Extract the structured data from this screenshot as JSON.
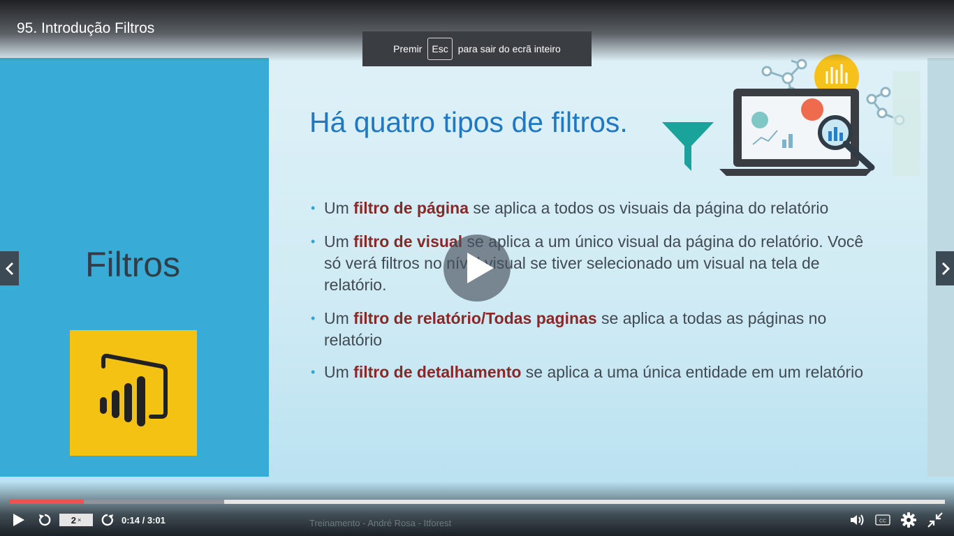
{
  "player": {
    "video_title": "95. Introdução Filtros",
    "fullscreen_notice": {
      "prefix": "Premir",
      "key": "Esc",
      "suffix": "para sair do ecrã inteiro"
    },
    "current_time": "0:14",
    "duration": "3:01",
    "time_display": "0:14 / 3:01",
    "playback_rate": "2",
    "playback_rate_suffix": "×",
    "progress_played_fraction": 0.08,
    "progress_buffered_fraction": 0.23,
    "icons": {
      "play": "play-icon",
      "rewind": "rewind-5s-icon",
      "forward": "forward-5s-icon",
      "volume": "volume-icon",
      "captions": "captions-icon",
      "settings": "gear-icon",
      "exit_fullscreen": "exit-fullscreen-icon",
      "prev": "chevron-left-icon",
      "next": "chevron-right-icon"
    },
    "colors": {
      "progress_played": "#ec5252",
      "progress_buffer": "#8f959b"
    }
  },
  "slide": {
    "left_title": "Filtros",
    "title": "Há quatro tipos de filtros.",
    "bullets": [
      {
        "pre": "Um ",
        "bold": "filtro de página",
        "post": " se aplica a todos os visuais da página do relatório"
      },
      {
        "pre": "Um ",
        "bold": "filtro de visual",
        "post": " se aplica a um único visual da página do relatório. Você só verá filtros no nível visual se tiver selecionado um visual na tela de relatório."
      },
      {
        "pre": "Um ",
        "bold": "filtro de relatório/Todas paginas",
        "post": " se aplica a todas as páginas no relatório"
      },
      {
        "pre": "Um ",
        "bold": "filtro de detalhamento",
        "post": " se aplica a uma única entidade em um relatório"
      }
    ],
    "watermark": "Treinamento - André Rosa - Itforest",
    "colors": {
      "left_panel": "#38acd6",
      "title": "#1f78c1",
      "emphasis": "#8b2727",
      "logo_bg": "#f4c213"
    }
  }
}
